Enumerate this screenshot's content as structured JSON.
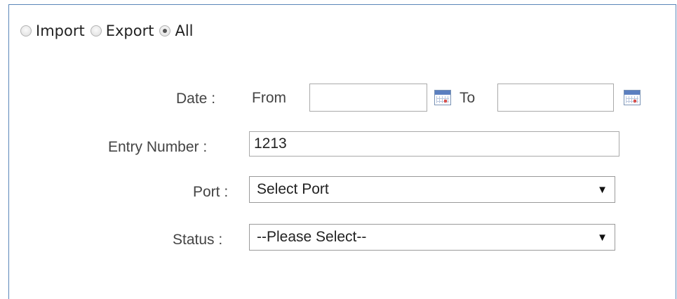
{
  "type_filter": {
    "options": [
      {
        "label": "Import",
        "checked": false
      },
      {
        "label": "Export",
        "checked": false
      },
      {
        "label": "All",
        "checked": true
      }
    ]
  },
  "date": {
    "label": "Date  :",
    "from_label": "From",
    "from_value": "",
    "to_label": "To",
    "to_value": "",
    "calendar_icon": "calendar-icon"
  },
  "entry_number": {
    "label": "Entry Number :",
    "value": "1213"
  },
  "port": {
    "label": "Port :",
    "selected": "Select Port",
    "caret": "▼"
  },
  "status": {
    "label": "Status :",
    "selected": "--Please Select--",
    "caret": "▼"
  },
  "colors": {
    "panel_border": "#5a86b8",
    "field_border": "#a9a9a9",
    "calendar_header": "#5b7fc0"
  }
}
